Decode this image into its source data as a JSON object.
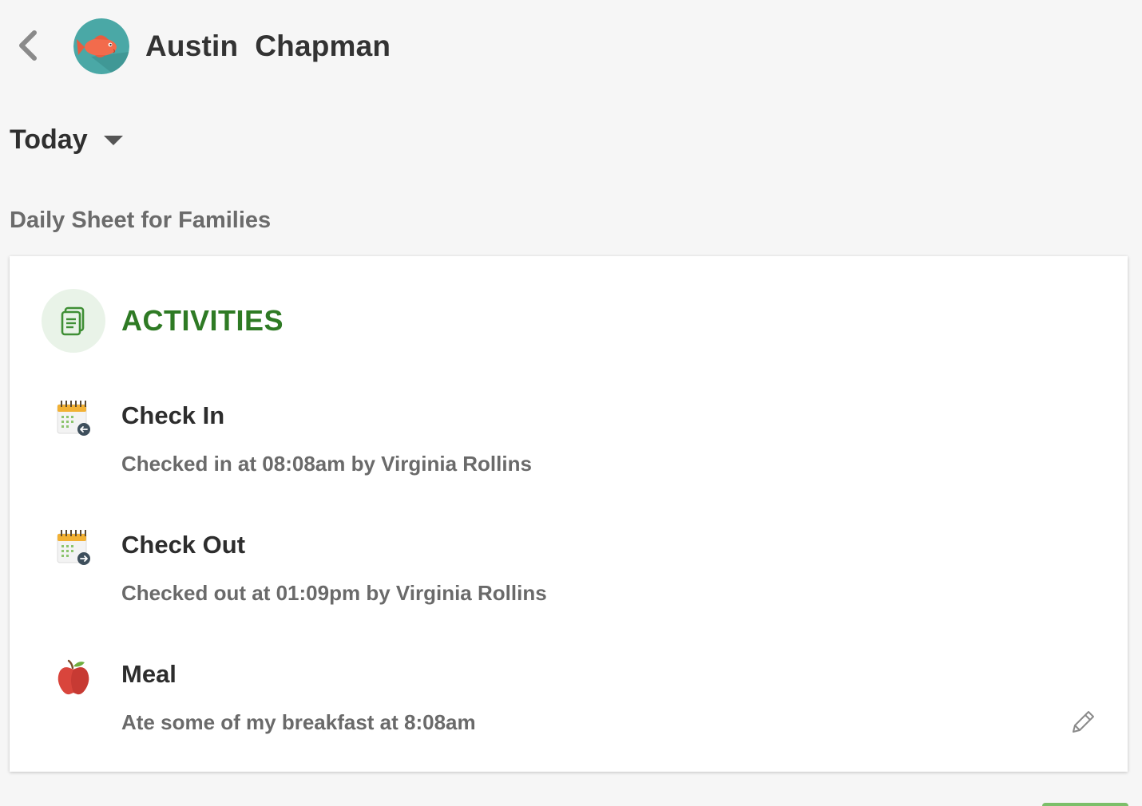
{
  "header": {
    "child_name": "Austin  Chapman",
    "avatar_icon": "fish-icon",
    "avatar_bg": "#4aa8a6"
  },
  "date_selector": {
    "label": "Today",
    "icon": "caret-down-icon"
  },
  "section_title": "Daily Sheet for Families",
  "card": {
    "title": "ACTIVITIES",
    "icon": "document-icon",
    "accent_color": "#2e7a24",
    "activities": [
      {
        "icon": "calendar-checkin-icon",
        "title": "Check In",
        "description": "Checked in at 08:08am by Virginia Rollins"
      },
      {
        "icon": "calendar-checkout-icon",
        "title": "Check Out",
        "description": "Checked out at 01:09pm by Virginia Rollins"
      },
      {
        "icon": "apple-icon",
        "title": "Meal",
        "description": "Ate some of my breakfast at 8:08am",
        "editable": true
      }
    ]
  }
}
